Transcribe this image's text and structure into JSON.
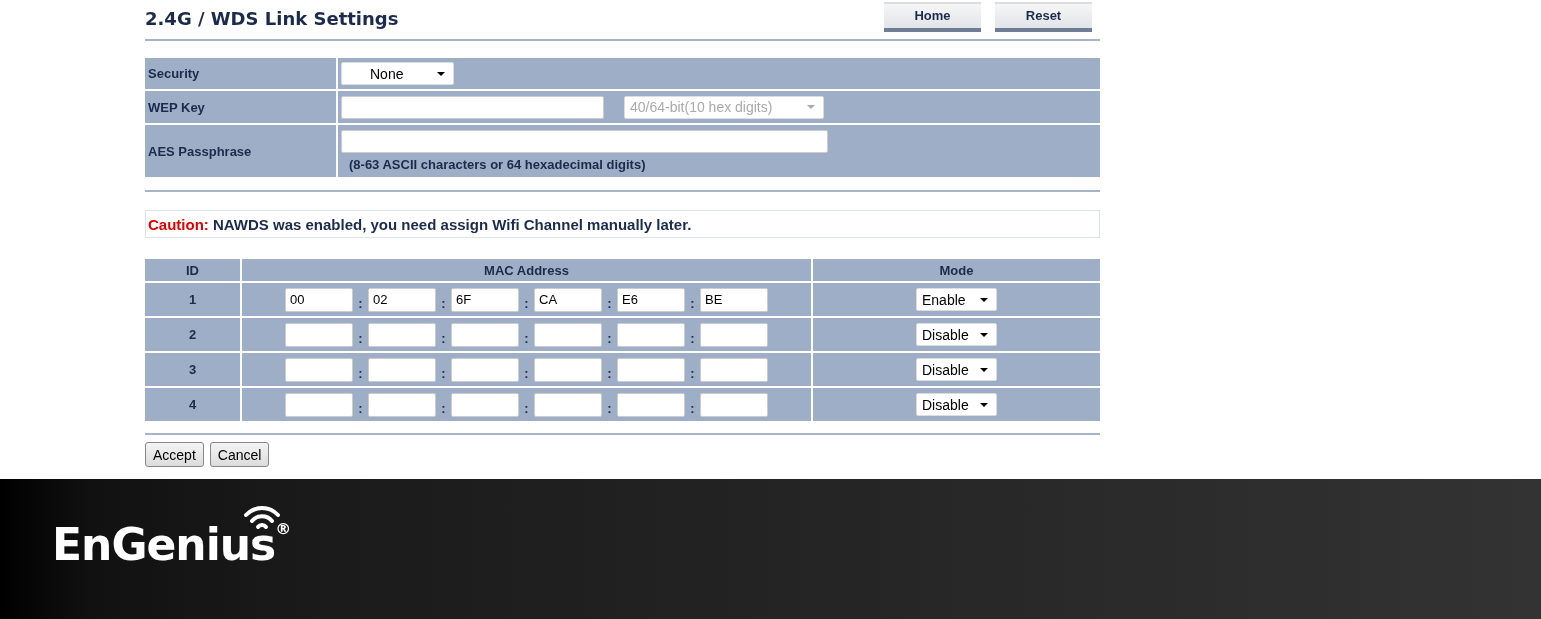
{
  "header": {
    "title": "2.4G / WDS Link Settings",
    "buttons": [
      "Home",
      "Reset"
    ]
  },
  "security": {
    "rows": [
      {
        "kind": "select",
        "label": "Security",
        "select": {
          "value": "None",
          "disabled": false
        }
      },
      {
        "kind": "key",
        "label": "WEP Key",
        "select": {
          "value": "40/64-bit(10 hex digits)",
          "disabled": true
        }
      },
      {
        "kind": "passphrase",
        "label": "AES Passphrase",
        "hint": "(8-63 ASCII characters or 64 hexadecimal digits)"
      }
    ]
  },
  "caution": {
    "label": "Caution:",
    "message": "NAWDS was enabled, you need assign Wifi Channel manually later."
  },
  "wds_table": {
    "columns": [
      "ID",
      "MAC Address",
      "Mode"
    ],
    "rows": [
      {
        "id": "1",
        "mac": [
          {
            "kind": "octet",
            "value": "00"
          },
          {
            "kind": "separator",
            "text": ":"
          },
          {
            "kind": "octet",
            "value": "02"
          },
          {
            "kind": "separator",
            "text": ":"
          },
          {
            "kind": "octet",
            "value": "6F"
          },
          {
            "kind": "separator",
            "text": ":"
          },
          {
            "kind": "octet",
            "value": "CA"
          },
          {
            "kind": "separator",
            "text": ":"
          },
          {
            "kind": "octet",
            "value": "E6"
          },
          {
            "kind": "separator",
            "text": ":"
          },
          {
            "kind": "octet",
            "value": "BE"
          }
        ],
        "mode": "Enable"
      },
      {
        "id": "2",
        "mac": [
          {
            "kind": "octet"
          },
          {
            "kind": "separator",
            "text": ":"
          },
          {
            "kind": "octet"
          },
          {
            "kind": "separator",
            "text": ":"
          },
          {
            "kind": "octet"
          },
          {
            "kind": "separator",
            "text": ":"
          },
          {
            "kind": "octet"
          },
          {
            "kind": "separator",
            "text": ":"
          },
          {
            "kind": "octet"
          },
          {
            "kind": "separator",
            "text": ":"
          },
          {
            "kind": "octet"
          }
        ],
        "mode": "Disable"
      },
      {
        "id": "3",
        "mac": [
          {
            "kind": "octet"
          },
          {
            "kind": "separator",
            "text": ":"
          },
          {
            "kind": "octet"
          },
          {
            "kind": "separator",
            "text": ":"
          },
          {
            "kind": "octet"
          },
          {
            "kind": "separator",
            "text": ":"
          },
          {
            "kind": "octet"
          },
          {
            "kind": "separator",
            "text": ":"
          },
          {
            "kind": "octet"
          },
          {
            "kind": "separator",
            "text": ":"
          },
          {
            "kind": "octet"
          }
        ],
        "mode": "Disable"
      },
      {
        "id": "4",
        "mac": [
          {
            "kind": "octet"
          },
          {
            "kind": "separator",
            "text": ":"
          },
          {
            "kind": "octet"
          },
          {
            "kind": "separator",
            "text": ":"
          },
          {
            "kind": "octet"
          },
          {
            "kind": "separator",
            "text": ":"
          },
          {
            "kind": "octet"
          },
          {
            "kind": "separator",
            "text": ":"
          },
          {
            "kind": "octet"
          },
          {
            "kind": "separator",
            "text": ":"
          },
          {
            "kind": "octet"
          }
        ],
        "mode": "Disable"
      }
    ]
  },
  "actions": [
    "Accept",
    "Cancel"
  ],
  "footer": {
    "logo": "EnGenius$^{®}$"
  }
}
